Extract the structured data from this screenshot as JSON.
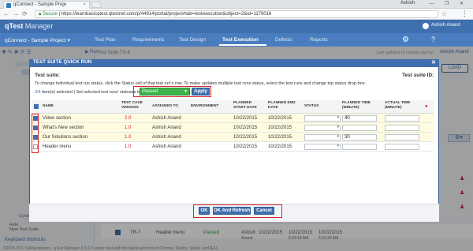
{
  "browser": {
    "tab_title": "qConnect - Sample Proje",
    "tab_close": "×",
    "user": "Ashish",
    "secure_label": "Secure",
    "url": "https://learnbasicqtest.qtestnet.com/p/44914/portal/project#tab=testexecution&object=2&id=1179016",
    "window_controls": "— ❐ ✕"
  },
  "app": {
    "logo_q": "qTest",
    "logo_m": "Manager",
    "user_name": "Ashish Anand",
    "project": "qConnect - Sample Project ▾",
    "tabs": [
      "Test Plan",
      "Requirements",
      "Test Design",
      "Test Execution",
      "Defects",
      "Reports"
    ],
    "help": "?"
  },
  "background": {
    "run_label": "▶ Run",
    "suite_header": "Test Suite TS-6",
    "last_updated": "Last updated 18 minutes ago by",
    "updated_by": "Ashish Anand",
    "load_btn": "LOAD",
    "row_id": "TR-7",
    "row_name": "Header menu",
    "row_status": "Passed",
    "row_user_1": "Ashish",
    "row_user_2": "Anand",
    "row_date": "10/22/2015",
    "row_time_1": "10/22/2015",
    "row_time_2": "6:03:18 AM",
    "row_time_3": "10/22/2015",
    "row_time_4": "6:03:23 AM",
    "tree_item_1": "Cycle 2",
    "tree_item_2": "Rele",
    "tree_item_3": "New Test Suite",
    "keyboard_shortcuts": "Keyboard shortcuts",
    "footer": "©2005-2017 QASymphony · qTest Manager 8.5.9.2 works best with the latest versions of Chrome, Firefox, Safari, and IE11."
  },
  "dialog": {
    "title": "TEST SUITE QUICK RUN",
    "suite_label": "Test suite:",
    "suite_id_label": "Test suite ID:",
    "hint": "To change individual test run status, click the Status cell of that test run's row. To make updates multiple test runs status, select the test runs and change top status drop-box.",
    "selected_count": "3/4",
    "selected_text": "item(s) selected  |  Set selected test runs' statuses to",
    "status_value": "Passed",
    "apply": "Apply",
    "columns": [
      "NAME",
      "TEST CASE VERSION",
      "ASSIGNED TO",
      "ENVIRONMENT",
      "PLANNED START DATE",
      "PLANNED END DATE",
      "STATUS",
      "PLANNED TIME (MINUTE)",
      "ACTUAL TIME (MINUTE)"
    ],
    "rows": [
      {
        "name": "Video section",
        "version": "2.0",
        "assigned": "Ashish Anand",
        "start": "10/22/2015",
        "end": "10/22/2015",
        "planned": "40",
        "checked": true
      },
      {
        "name": "What's New section",
        "version": "1.0",
        "assigned": "Ashish Anand",
        "start": "10/22/2015",
        "end": "10/22/2015",
        "planned": "",
        "checked": true
      },
      {
        "name": "Our Solutions section",
        "version": "1.0",
        "assigned": "Ashish Anand",
        "start": "10/22/2015",
        "end": "10/22/2015",
        "planned": "30",
        "checked": true
      },
      {
        "name": "Header menu",
        "version": "1.0",
        "assigned": "Ashish Anand",
        "start": "10/22/2015",
        "end": "10/22/2015",
        "planned": "",
        "checked": false
      }
    ],
    "ok": "OK",
    "ok_refresh": "OK And Refresh",
    "cancel": "Cancel"
  },
  "colors": {
    "header_blue": "#3f6fae",
    "passed_green": "#3cb44b",
    "highlight_red": "#d7262e"
  }
}
